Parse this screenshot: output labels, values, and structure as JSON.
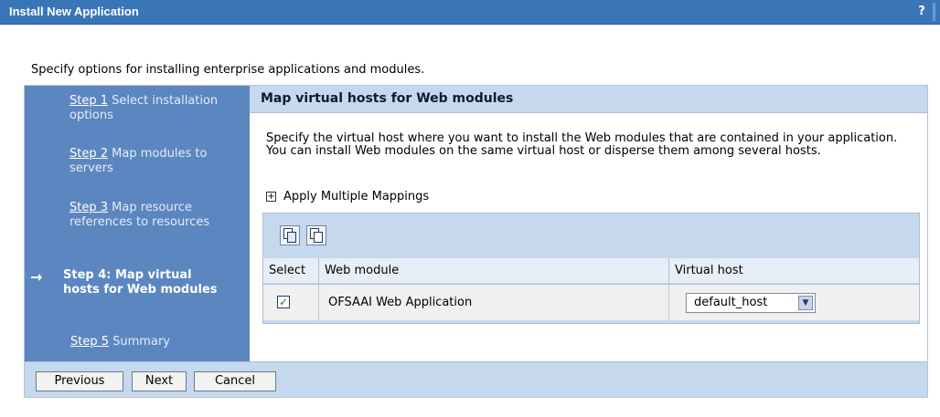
{
  "window": {
    "title": "Install New Application",
    "help_glyph": "?"
  },
  "intro": "Specify options for installing enterprise applications and modules.",
  "steps": [
    {
      "link": "Step 1",
      "rest": "Select installation options"
    },
    {
      "link": "Step 2",
      "rest": "Map modules to servers"
    },
    {
      "link": "Step 3",
      "rest": "Map resource references to resources"
    },
    {
      "label": "Step 4: Map virtual hosts for Web modules"
    },
    {
      "link": "Step 5",
      "rest": "Summary"
    }
  ],
  "current_arrow": "→",
  "section": {
    "heading": "Map virtual hosts for Web modules",
    "description": "Specify the virtual host where you want to install the Web modules that are contained in your application. You can install Web modules on the same virtual host or disperse them among several hosts.",
    "expand_glyph": "+",
    "expand_label": "Apply Multiple Mappings"
  },
  "table": {
    "columns": [
      "Select",
      "Web module",
      "Virtual host"
    ],
    "rows": [
      {
        "checked": "✓",
        "web_module": "OFSAAI Web Application",
        "virtual_host": "default_host"
      }
    ],
    "select_arrow": "▼"
  },
  "buttons": {
    "previous": "Previous",
    "next": "Next",
    "cancel": "Cancel"
  }
}
